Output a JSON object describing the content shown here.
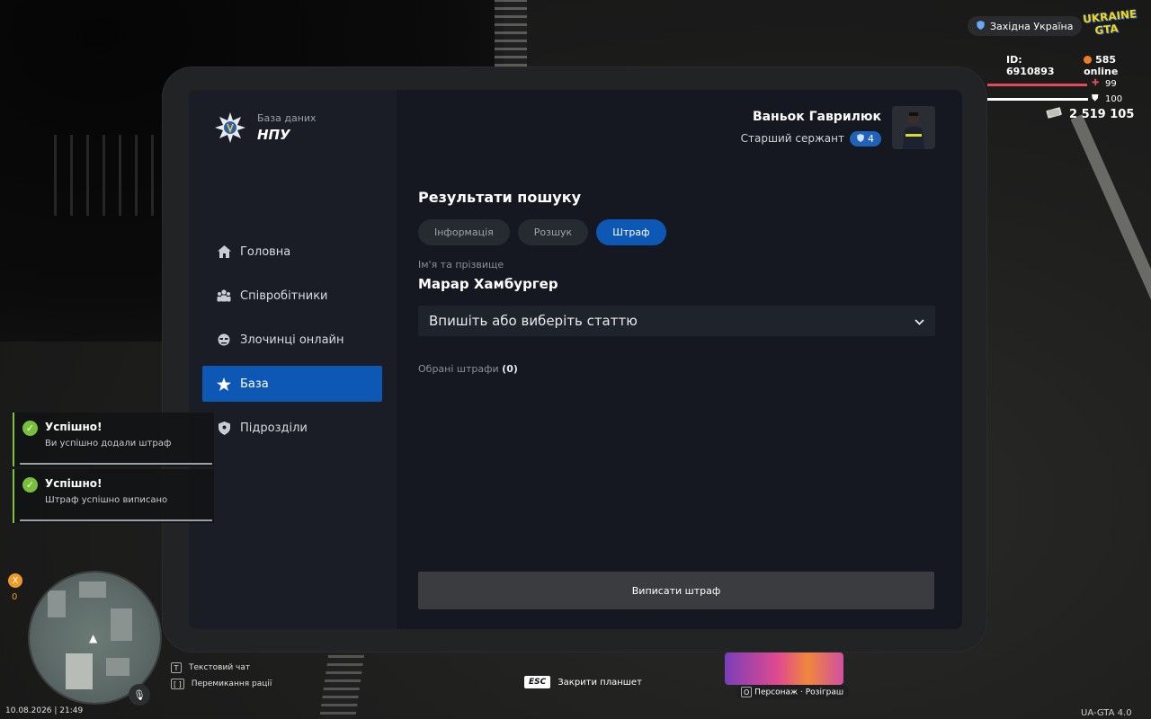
{
  "brand": {
    "subtitle": "База даних",
    "title": "НПУ"
  },
  "sidebar": {
    "items": [
      {
        "label": "Головна",
        "icon": "home-icon",
        "active": false
      },
      {
        "label": "Співробітники",
        "icon": "staff-icon",
        "active": false
      },
      {
        "label": "Злочинці онлайн",
        "icon": "criminal-icon",
        "active": false
      },
      {
        "label": "База",
        "icon": "star-icon",
        "active": true
      },
      {
        "label": "Підрозділи",
        "icon": "shield-icon",
        "active": false
      }
    ]
  },
  "user": {
    "name": "Ваньок Гаврилюк",
    "rank": "Старший сержант",
    "rank_level": "4"
  },
  "main": {
    "section_title": "Результати пошуку",
    "tabs": [
      {
        "label": "Інформація",
        "active": false
      },
      {
        "label": "Розшук",
        "active": false
      },
      {
        "label": "Штраф",
        "active": true
      }
    ],
    "name_label": "Ім'я та прізвище",
    "name_value": "Марар Хамбургер",
    "article_placeholder": "Впишіть або виберіть статтю",
    "selected_label": "Обрані штрафи",
    "selected_count": "(0)",
    "submit_label": "Виписати штраф"
  },
  "hud": {
    "region": "Західна Україна",
    "logo_line1": "UKRAINE",
    "logo_line2": "GTA",
    "player_id": "ID: 6910893",
    "online": "585 online",
    "health": "99",
    "armor": "100",
    "health_fraction": 0.99,
    "armor_fraction": 1.0,
    "money": "2 519 105",
    "colors": {
      "accent": "#0d58b4",
      "health": "#e04a5a",
      "success": "#78c03c",
      "orange": "#f09a26"
    }
  },
  "notifications": [
    {
      "title": "Успішно!",
      "message": "Ви успішно додали штраф"
    },
    {
      "title": "Успішно!",
      "message": "Штраф успішно виписано"
    }
  ],
  "minimap": {
    "badge": "X",
    "count": "0",
    "datetime": "10.08.2026 | 21:49"
  },
  "hints": [
    {
      "key": "T",
      "label": "Текстовий чат"
    },
    {
      "key": "[  ]",
      "label": "Перемикання рації"
    }
  ],
  "esc_hint": {
    "key": "ESC",
    "label": "Закрити планшет"
  },
  "promo": {
    "label": "Персонаж · Розіграш",
    "key": "O"
  },
  "version": "UA-GTA 4.0"
}
